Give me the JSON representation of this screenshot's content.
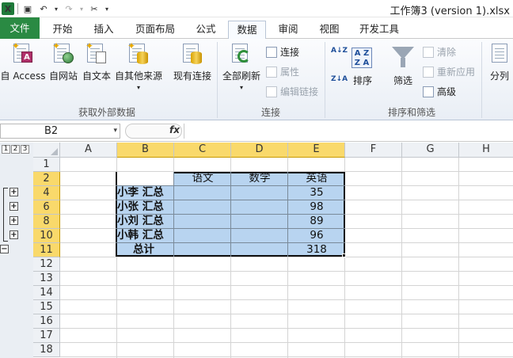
{
  "window": {
    "title": "工作簿3 (version 1).xlsx"
  },
  "tabs": [
    "文件",
    "开始",
    "插入",
    "页面布局",
    "公式",
    "数据",
    "审阅",
    "视图",
    "开发工具"
  ],
  "active_tab": "数据",
  "ribbon": {
    "from_access": "自 Access",
    "from_web": "自网站",
    "from_text": "自文本",
    "from_other": "自其他来源",
    "existing": "现有连接",
    "group_external": "获取外部数据",
    "refresh_all": "全部刷新",
    "connections": "连接",
    "properties": "属性",
    "edit_links": "编辑链接",
    "group_connections": "连接",
    "sort": "排序",
    "filter": "筛选",
    "clear": "清除",
    "reapply": "重新应用",
    "advanced": "高级",
    "group_sort_filter": "排序和筛选",
    "split": "分列",
    "sort_asc": "A↓Z",
    "sort_desc": "Z↓A",
    "sort_box": "A Z Z A"
  },
  "formula_bar": {
    "name_box": "B2",
    "fx": "fx",
    "formula": ""
  },
  "outline_levels": [
    "1",
    "2",
    "3"
  ],
  "outline_buttons": [
    "+",
    "+",
    "+",
    "+",
    "−"
  ],
  "columns": [
    "A",
    "B",
    "C",
    "D",
    "E",
    "F",
    "G",
    "H"
  ],
  "rows": [
    "1",
    "2",
    "4",
    "6",
    "8",
    "10",
    "11",
    "12",
    "13",
    "14",
    "15",
    "16",
    "17",
    "18"
  ],
  "sheet": {
    "header": {
      "c": "语文",
      "d": "数学",
      "e": "英语"
    },
    "rows": [
      {
        "b": "小李  汇总",
        "e": "35"
      },
      {
        "b": "小张  汇总",
        "e": "98"
      },
      {
        "b": "小刘  汇总",
        "e": "89"
      },
      {
        "b": "小韩  汇总",
        "e": "96"
      },
      {
        "b": "总计",
        "e": "318"
      }
    ]
  }
}
